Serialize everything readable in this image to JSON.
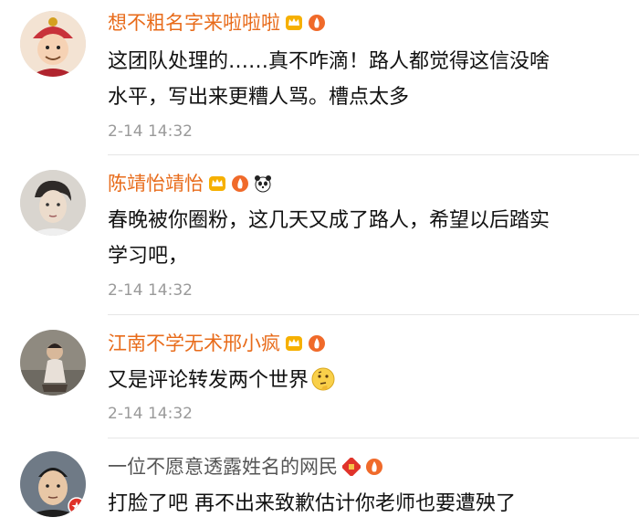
{
  "comments": [
    {
      "username": "想不粗名字来啦啦啦",
      "line1": "这团队处理的……真不咋滴！路人都觉得这信没啥",
      "line2": "水平，写出来更糟人骂。槽点太多",
      "time": "2-14 14:32",
      "badges": [
        "crown-icon",
        "fire-icon"
      ]
    },
    {
      "username": "陈靖怡靖怡",
      "line1": "春晚被你圈粉，这几天又成了路人，希望以后踏实",
      "line2": "学习吧，",
      "time": "2-14 14:32",
      "badges": [
        "crown-icon",
        "fire-icon",
        "panda-icon"
      ]
    },
    {
      "username": "江南不学无术邢小疯",
      "line1": "又是评论转发两个世界",
      "line2": "",
      "time": "2-14 14:32",
      "badges": [
        "crown-icon",
        "fire-icon"
      ],
      "emoji": "thinking-face-icon"
    },
    {
      "username": "一位不愿意透露姓名的网民",
      "line1": "打脸了吧  再不出来致歉估计你老师也要遭殃了",
      "line2": "",
      "time": "",
      "badges": [
        "fu-icon",
        "fire-icon"
      ]
    }
  ],
  "colors": {
    "username": "#e86b1a",
    "username_gray": "#555555",
    "time": "#9a9a9a",
    "divider": "#e6e6e6"
  }
}
